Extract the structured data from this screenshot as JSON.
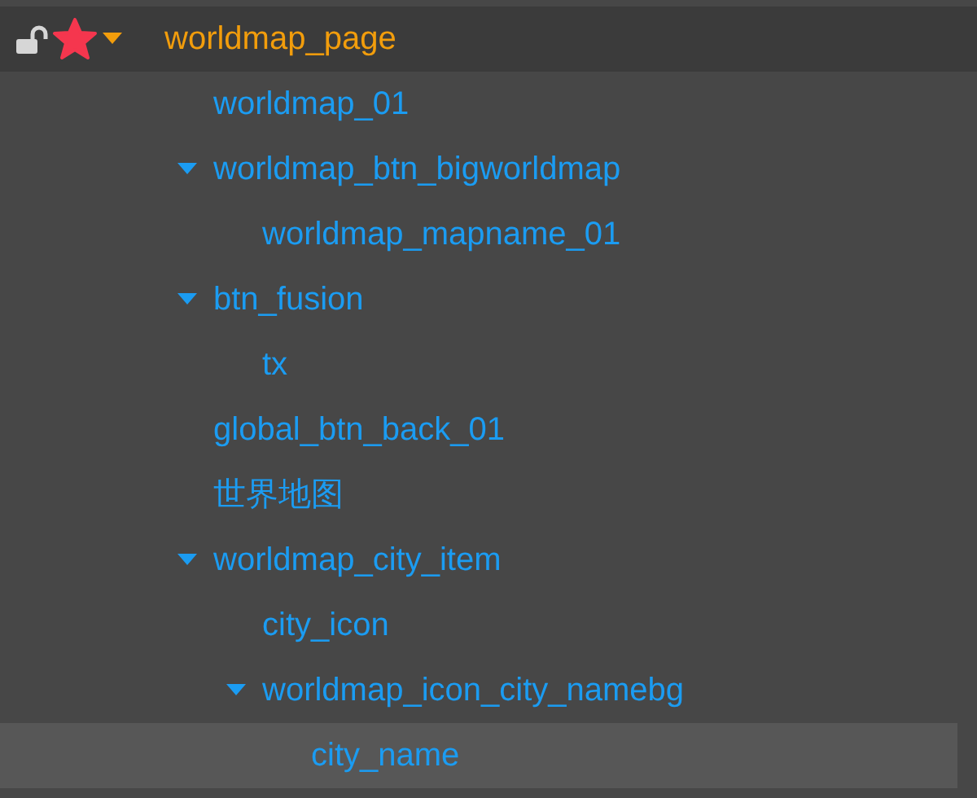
{
  "tree": {
    "label": "worldmap_page",
    "locked": false,
    "expanded": true,
    "selected": false,
    "children": [
      {
        "label": "worldmap_01",
        "selected": false
      },
      {
        "label": "worldmap_btn_bigworldmap",
        "expanded": true,
        "selected": false,
        "children": [
          {
            "label": "worldmap_mapname_01",
            "selected": false
          }
        ]
      },
      {
        "label": "btn_fusion",
        "expanded": true,
        "selected": false,
        "children": [
          {
            "label": "tx",
            "selected": false
          }
        ]
      },
      {
        "label": "global_btn_back_01",
        "selected": false
      },
      {
        "label": "世界地图",
        "selected": false
      },
      {
        "label": "worldmap_city_item",
        "expanded": true,
        "selected": false,
        "children": [
          {
            "label": "city_icon",
            "selected": false
          },
          {
            "label": "worldmap_icon_city_namebg",
            "expanded": true,
            "selected": false,
            "children": [
              {
                "label": "city_name",
                "selected": true
              }
            ]
          }
        ]
      }
    ]
  }
}
